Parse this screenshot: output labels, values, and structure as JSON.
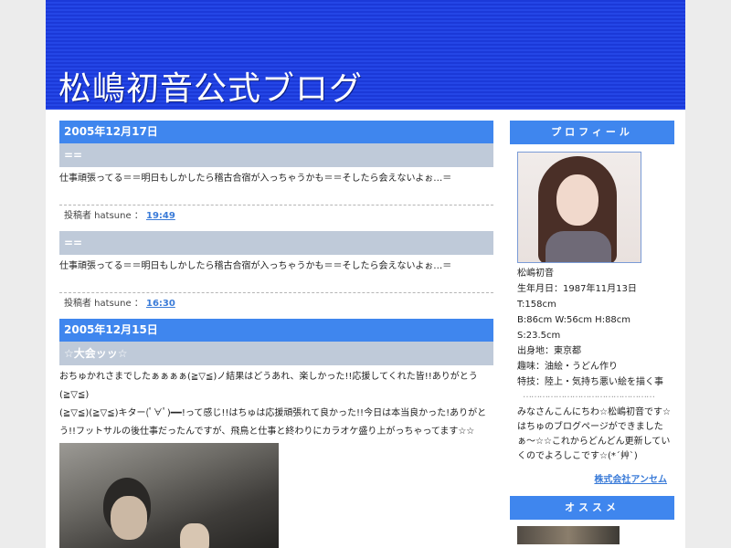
{
  "blog": {
    "title": "松嶋初音公式ブログ"
  },
  "entries": [
    {
      "date": "2005年12月17日",
      "posts": [
        {
          "title": "==",
          "body": [
            "仕事頑張ってる＝＝明日もしかしたら稽古合宿が入っちゃうかも＝＝そしたら会えないよぉ…＝"
          ],
          "footer_prefix": "投稿者 hatsune ：",
          "time": "19:49"
        },
        {
          "title": "==",
          "body": [
            "仕事頑張ってる＝＝明日もしかしたら稽古合宿が入っちゃうかも＝＝そしたら会えないよぉ…＝"
          ],
          "footer_prefix": "投稿者 hatsune ：",
          "time": "16:30"
        }
      ]
    },
    {
      "date": "2005年12月15日",
      "posts": [
        {
          "title": "☆大会ッッ☆",
          "body": [
            "おちゅかれさまでしたぁぁぁぁ(≧▽≦)ノ結果はどうあれ、楽しかった!!応援してくれた皆!!ありがとう(≧▽≦)",
            "(≧▽≦)(≧▽≦)キター(ﾟ∀ﾟ)━━!って感じ!!はちゅは応援頑張れて良かった!!今日は本当良かった!ありがと",
            "う!!フットサルの後仕事だったんですが、飛鳥と仕事と終わりにカラオケ盛り上がっちゃってます☆☆"
          ]
        }
      ]
    }
  ],
  "sidebar": {
    "profile": {
      "heading": "プロフィール",
      "info": [
        "松嶋初音",
        "生年月日：1987年11月13日",
        "T:158cm",
        "B:86cm W:56cm H:88cm",
        "S:23.5cm",
        "出身地：東京都",
        "趣味：油絵・うどん作り",
        "特技：陸上・気持ち悪い絵を描く事"
      ],
      "separator": "…………………………………………",
      "message": "みなさんこんにちわ☆松嶋初音です☆はちゅのブログページができましたぁ～☆☆これからどんどん更新していくのでよろしこです☆(*´艸`)",
      "company_link": "株式会社アンセム"
    },
    "recommend": {
      "heading": "オススメ"
    }
  }
}
